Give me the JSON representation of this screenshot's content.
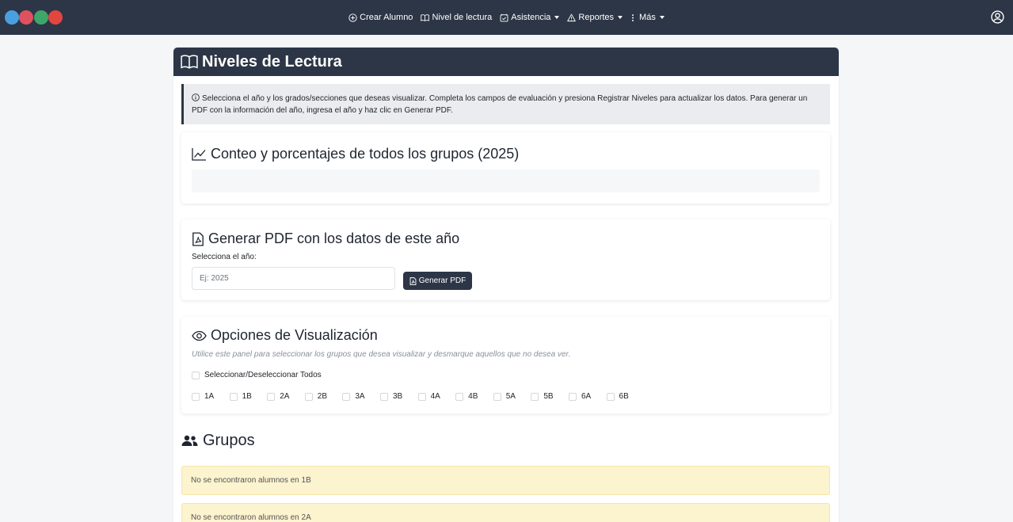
{
  "navbar": {
    "logo_colors": [
      "#4a9fe0",
      "#e0515f",
      "#3fa66a",
      "#e2463f"
    ],
    "items": [
      {
        "label": "Crear Alumno",
        "icon": "plus-circle-icon",
        "dropdown": false
      },
      {
        "label": "Nivel de lectura",
        "icon": "book-icon",
        "dropdown": false
      },
      {
        "label": "Asistencia",
        "icon": "calendar-check-icon",
        "dropdown": true
      },
      {
        "label": "Reportes",
        "icon": "warning-icon",
        "dropdown": true
      },
      {
        "label": "Más",
        "icon": "vertical-dots-icon",
        "dropdown": true
      }
    ],
    "user_icon": "user-circle-icon"
  },
  "page": {
    "title": "Niveles de Lectura",
    "info_text": "Selecciona el año y los grados/secciones que deseas visualizar. Completa los campos de evaluación y presiona Registrar Niveles para actualizar los datos. Para generar un PDF con la información del año, ingresa el año y haz clic en Generar PDF."
  },
  "stats_section": {
    "title": "Conteo y porcentajes de todos los grupos (2025)"
  },
  "pdf_section": {
    "title": "Generar PDF con los datos de este año",
    "year_label": "Selecciona el año:",
    "year_placeholder": "Ej: 2025",
    "year_value": "",
    "button_label": "Generar PDF"
  },
  "view_section": {
    "title": "Opciones de Visualización",
    "hint": "Utilice este panel para seleccionar los grupos que desea visualizar y desmarque aquellos que no desea ver.",
    "select_all_label": "Seleccionar/Deseleccionar Todos",
    "groups": [
      "1A",
      "1B",
      "2A",
      "2B",
      "3A",
      "3B",
      "4A",
      "4B",
      "5A",
      "5B",
      "6A",
      "6B"
    ]
  },
  "groups_section": {
    "title": "Grupos",
    "alerts": [
      "No se encontraron alumnos en 1B",
      "No se encontraron alumnos en 2A"
    ]
  },
  "colors": {
    "navbar_bg": "#2c3646",
    "alert_warning_bg": "#fcf3cf",
    "info_bg": "#ebecef"
  }
}
